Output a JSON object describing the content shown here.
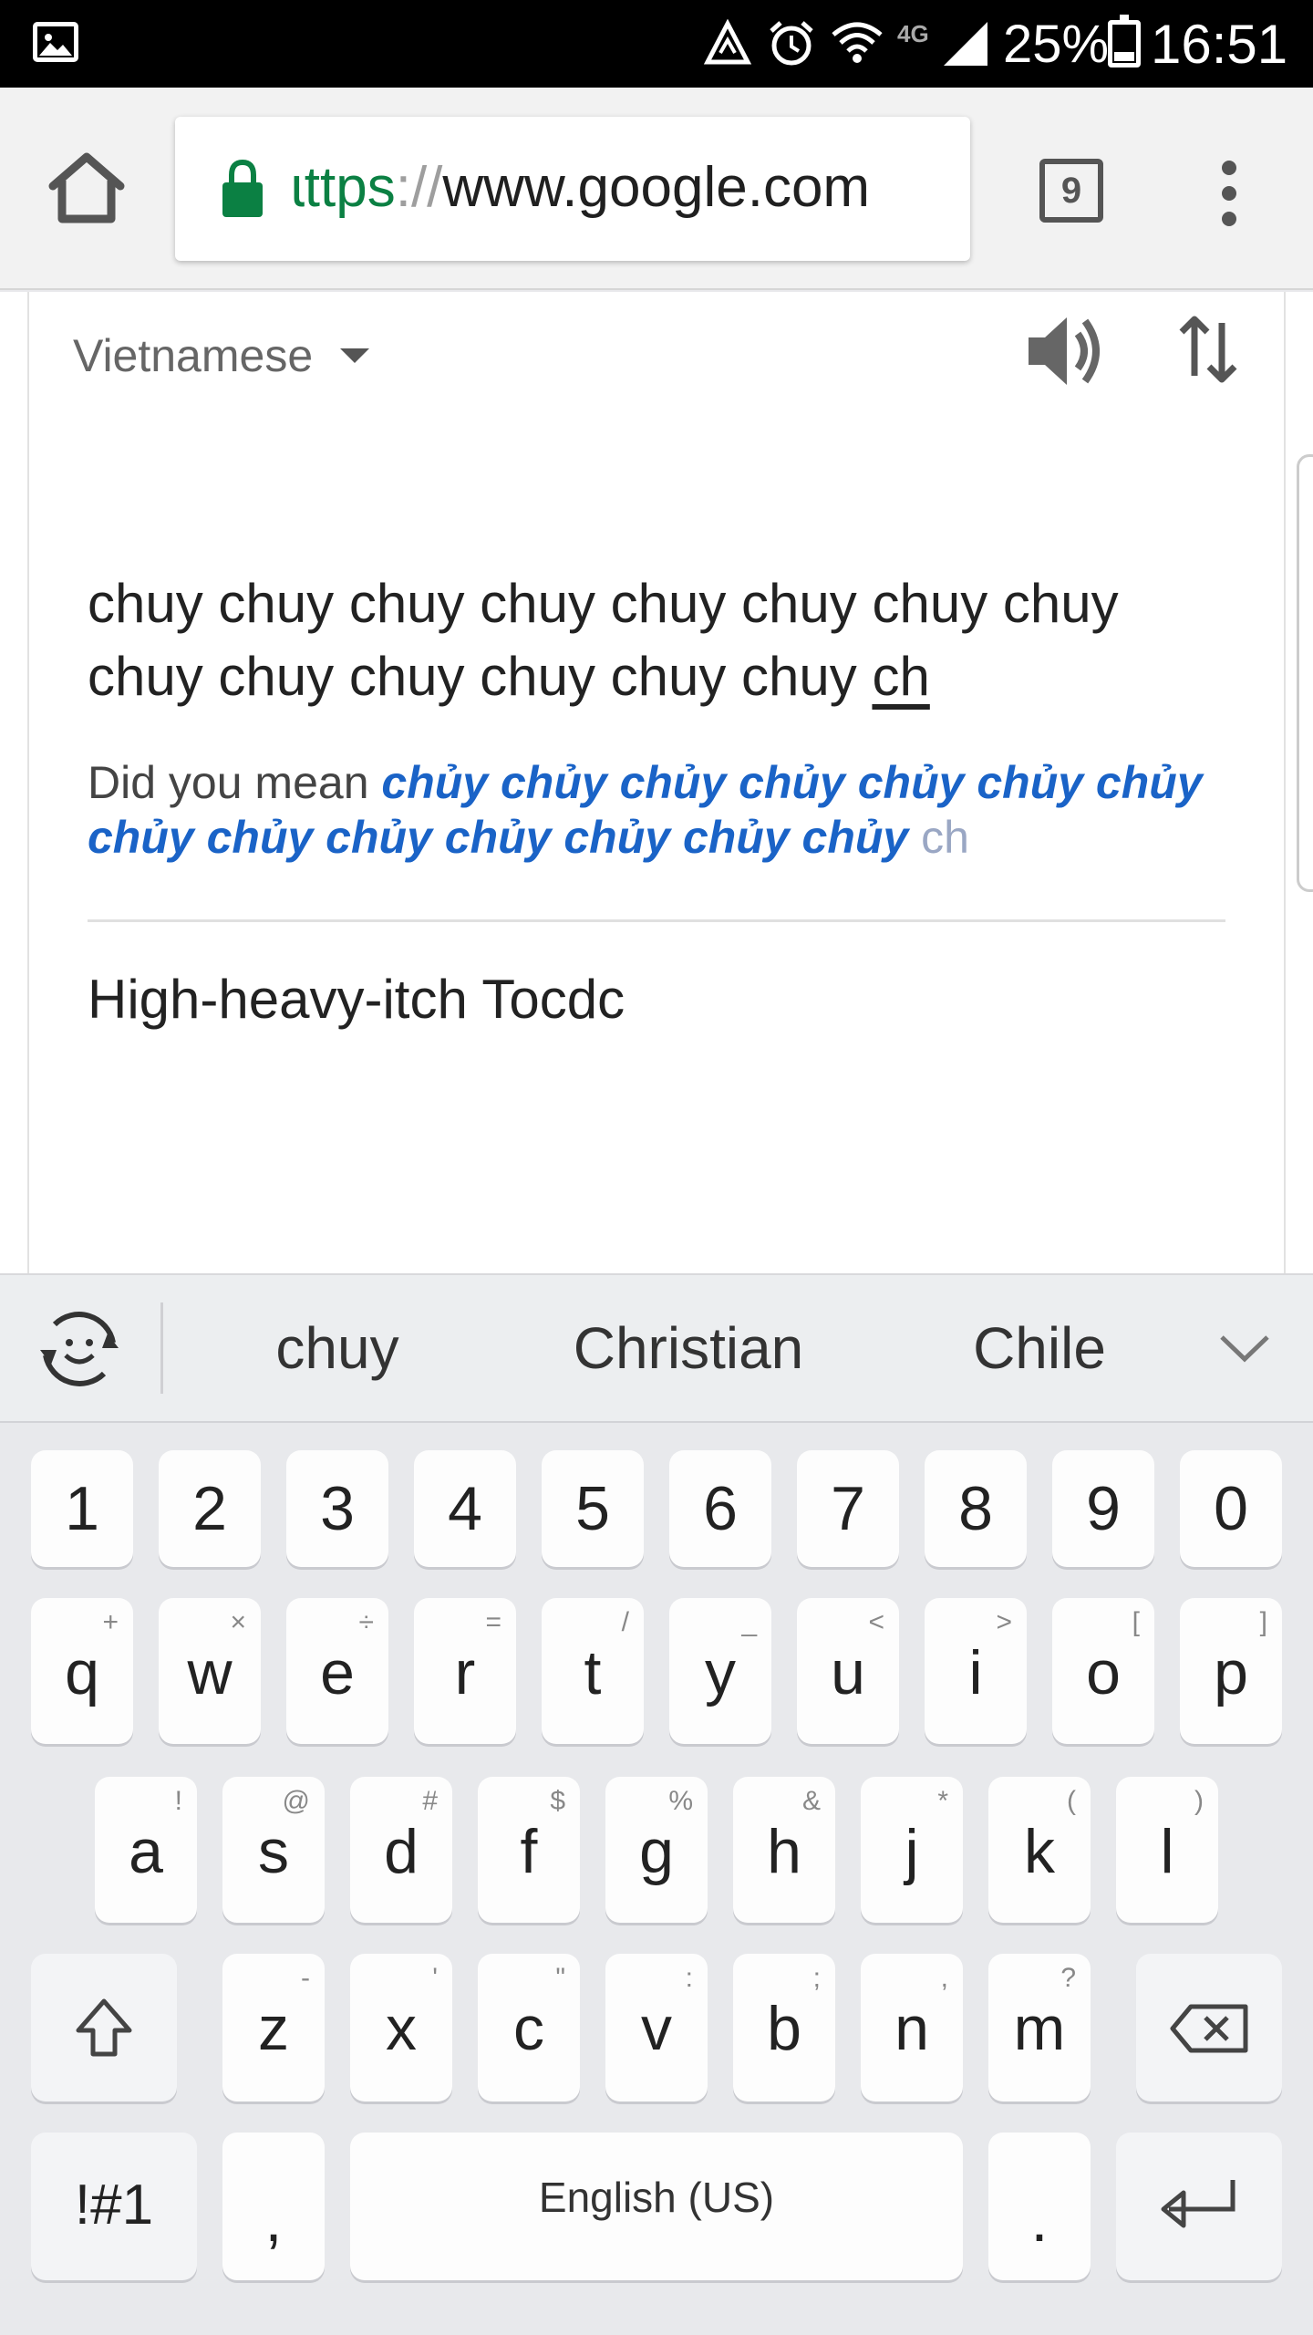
{
  "status_bar": {
    "battery_percent": "25%",
    "battery_level": 0.25,
    "time": "16:51",
    "network_label": "4G",
    "icons": [
      "gallery-icon",
      "data-saver-icon",
      "alarm-icon",
      "wifi-icon",
      "signal-icon",
      "battery-icon"
    ]
  },
  "browser": {
    "url_scheme": "ɩttps",
    "url_sep": "://",
    "url_host": "www.google.com",
    "tab_count": "9",
    "icons": [
      "home-icon",
      "lock-icon",
      "tab-switcher-icon",
      "overflow-menu-icon"
    ]
  },
  "translate": {
    "source_language": "Vietnamese",
    "source_text": "chuy chuy chuy chuy chuy chuy chuy chuy chuy chuy chuy chuy chuy chuy ",
    "source_text_underlined": "ch",
    "did_you_mean_label": "Did you mean ",
    "did_you_mean_suggestion": "chủy chủy chủy chủy chủy chủy chủy chủy chủy chủy chủy chủy chủy chủy",
    "did_you_mean_rest": " ch",
    "translation": "High-heavy-itch Tocdc"
  },
  "keyboard": {
    "suggestions": [
      "chuy",
      "Christian",
      "Chile"
    ],
    "number_row": [
      "1",
      "2",
      "3",
      "4",
      "5",
      "6",
      "7",
      "8",
      "9",
      "0"
    ],
    "row1": [
      {
        "key": "q",
        "sub": "+"
      },
      {
        "key": "w",
        "sub": "×"
      },
      {
        "key": "e",
        "sub": "÷"
      },
      {
        "key": "r",
        "sub": "="
      },
      {
        "key": "t",
        "sub": "/"
      },
      {
        "key": "y",
        "sub": "_"
      },
      {
        "key": "u",
        "sub": "<"
      },
      {
        "key": "i",
        "sub": ">"
      },
      {
        "key": "o",
        "sub": "["
      },
      {
        "key": "p",
        "sub": "]"
      }
    ],
    "row2": [
      {
        "key": "a",
        "sub": "!"
      },
      {
        "key": "s",
        "sub": "@"
      },
      {
        "key": "d",
        "sub": "#"
      },
      {
        "key": "f",
        "sub": "$"
      },
      {
        "key": "g",
        "sub": "%"
      },
      {
        "key": "h",
        "sub": "&"
      },
      {
        "key": "j",
        "sub": "*"
      },
      {
        "key": "k",
        "sub": "("
      },
      {
        "key": "l",
        "sub": ")"
      }
    ],
    "row3": [
      {
        "key": "z",
        "sub": "-"
      },
      {
        "key": "x",
        "sub": "'"
      },
      {
        "key": "c",
        "sub": "\""
      },
      {
        "key": "v",
        "sub": ":"
      },
      {
        "key": "b",
        "sub": ";"
      },
      {
        "key": "n",
        "sub": ","
      },
      {
        "key": "m",
        "sub": "?"
      }
    ],
    "symbols_label": "!#1",
    "comma_label": ",",
    "space_label": "English (US)",
    "period_label": ".",
    "icons": [
      "emoji-icon",
      "chevron-down-icon",
      "shift-icon",
      "backspace-icon",
      "enter-icon"
    ]
  }
}
